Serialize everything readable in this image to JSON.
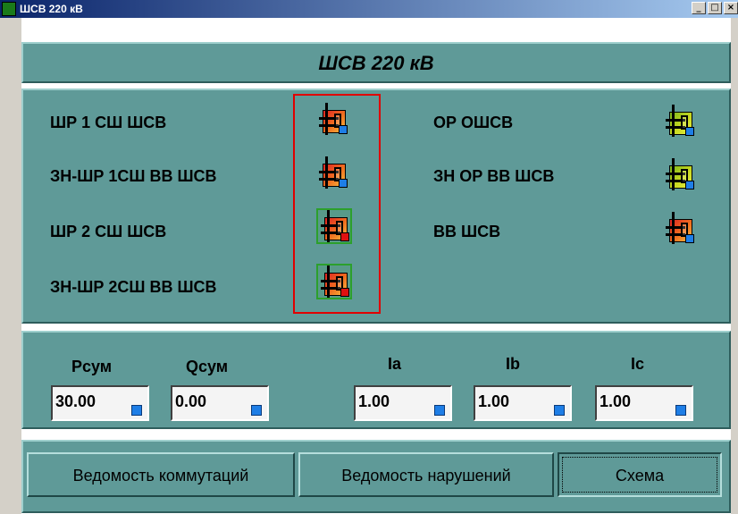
{
  "window": {
    "title": "ШСВ 220 кВ",
    "btn_min": "_",
    "btn_max": "□",
    "btn_close": "×"
  },
  "header": {
    "title": "ШСВ 220 кВ"
  },
  "switches_left": [
    {
      "label": "ШР 1 СШ ШСВ",
      "state_color": "red",
      "indicator": "blue"
    },
    {
      "label": "ЗН-ШР 1СШ ВВ ШСВ",
      "state_color": "red",
      "indicator": "blue"
    },
    {
      "label": "ШР 2 СШ ШСВ",
      "state_color": "red",
      "indicator": "red"
    },
    {
      "label": "ЗН-ШР 2СШ ВВ ШСВ",
      "state_color": "red",
      "indicator": "red"
    }
  ],
  "switches_right": [
    {
      "label": "ОР ОШСВ",
      "state_color": "yellow",
      "indicator": "blue"
    },
    {
      "label": "ЗН ОР ВВ ШСВ",
      "state_color": "yellow",
      "indicator": "blue"
    },
    {
      "label": "ВВ ШСВ",
      "state_color": "red",
      "indicator": "blue"
    }
  ],
  "measurements": {
    "p": {
      "label": "Рсум",
      "value": "30.00"
    },
    "q": {
      "label": "Qсум",
      "value": "0.00"
    },
    "ia": {
      "label": "Ia",
      "value": "1.00"
    },
    "ib": {
      "label": "Ib",
      "value": "1.00"
    },
    "ic": {
      "label": "Ic",
      "value": "1.00"
    }
  },
  "buttons": {
    "switching_log": "Ведомость коммутаций",
    "violations_log": "Ведомость нарушений",
    "scheme": "Схема"
  },
  "colors": {
    "panel": "#5f9a98",
    "highlight_frame": "#e00000",
    "indicator_blue": "#1e7ee6"
  }
}
